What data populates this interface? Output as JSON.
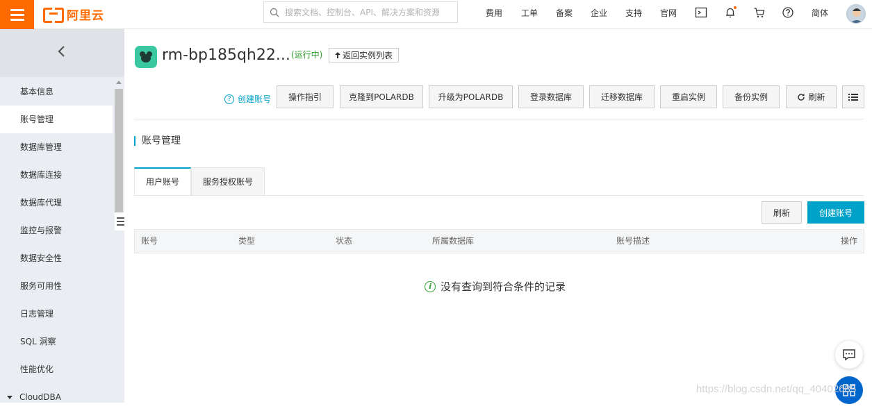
{
  "topbar": {
    "logo_text": "阿里云",
    "search_placeholder": "搜索文档、控制台、API、解决方案和资源",
    "nav": [
      "费用",
      "工单",
      "备案",
      "企业",
      "支持",
      "官网"
    ],
    "language": "简体",
    "accent": "#ff6a00"
  },
  "sidebar": {
    "items": [
      {
        "label": "基本信息",
        "active": false
      },
      {
        "label": "账号管理",
        "active": true
      },
      {
        "label": "数据库管理",
        "active": false
      },
      {
        "label": "数据库连接",
        "active": false
      },
      {
        "label": "数据库代理",
        "active": false
      },
      {
        "label": "监控与报警",
        "active": false
      },
      {
        "label": "数据安全性",
        "active": false
      },
      {
        "label": "服务可用性",
        "active": false
      },
      {
        "label": "日志管理",
        "active": false
      },
      {
        "label": "SQL 洞察",
        "active": false
      },
      {
        "label": "性能优化",
        "active": false
      },
      {
        "label": "CloudDBA",
        "active": false
      }
    ]
  },
  "instance": {
    "name": "rm-bp185qh22...",
    "status": "(运行中)",
    "back_label": "返回实例列表",
    "icon_color": "#3ac8a0"
  },
  "toolbar": {
    "create_account_link": "创建账号",
    "buttons": [
      "操作指引",
      "克隆到POLARDB",
      "升级为POLARDB",
      "登录数据库",
      "迁移数据库",
      "重启实例",
      "备份实例",
      "刷新"
    ]
  },
  "section": {
    "title": "账号管理",
    "tabs": [
      "用户账号",
      "服务授权账号"
    ],
    "refresh_label": "刷新",
    "create_label": "创建账号",
    "columns": [
      "账号",
      "类型",
      "状态",
      "所属数据库",
      "账号描述",
      "操作"
    ],
    "empty_text": "没有查询到符合条件的记录",
    "primary_color": "#00a2ca"
  },
  "watermark": "https://blog.csdn.net/qq_40402685"
}
